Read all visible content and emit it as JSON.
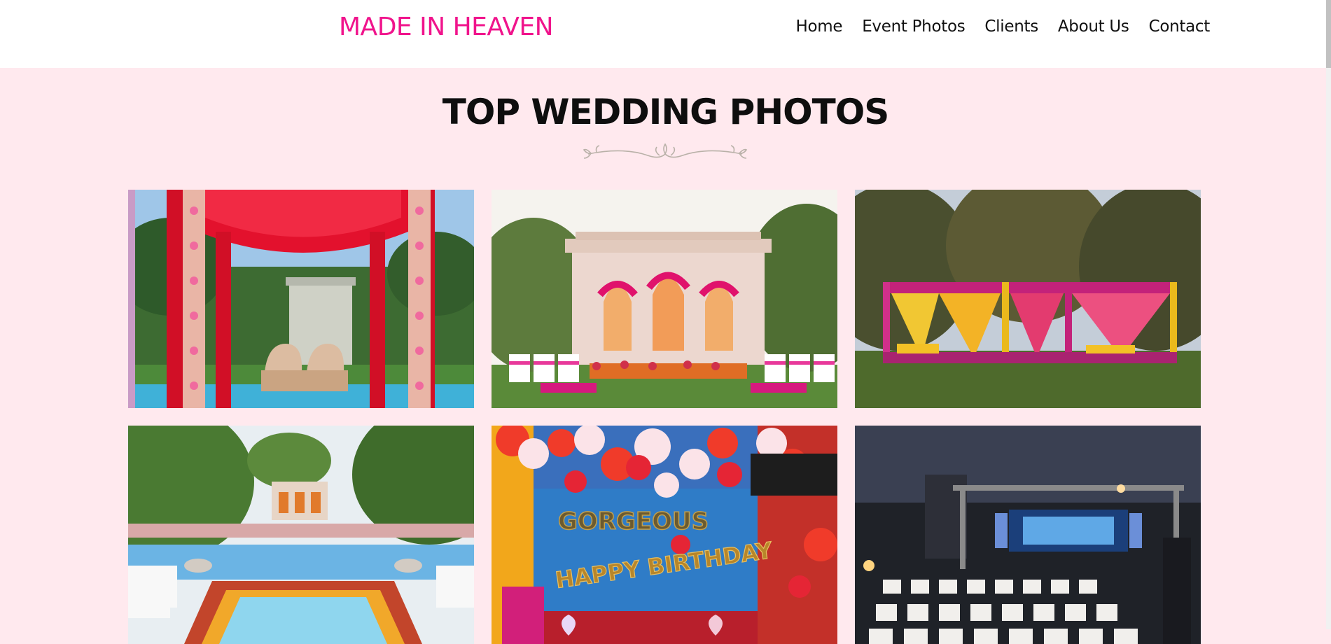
{
  "header": {
    "brand": "MADE IN HEAVEN",
    "nav": [
      {
        "label": "Home"
      },
      {
        "label": "Event Photos"
      },
      {
        "label": "Clients"
      },
      {
        "label": "About Us"
      },
      {
        "label": "Contact"
      }
    ]
  },
  "main": {
    "heading": "TOP WEDDING PHOTOS",
    "divider_icon": "floral-divider-icon"
  },
  "gallery": {
    "photos": [
      {
        "subject": "Red mandap with floral pillars and two gold chairs by pool"
      },
      {
        "subject": "White palace stage with pink arches and white chairs on lawn"
      },
      {
        "subject": "Colorful yellow and pink drape gazebos on lawn at sunset"
      },
      {
        "subject": "Poolside decor with white palace and flower borders"
      },
      {
        "subject": "Happy Birthday balloon decor with red and white balloons"
      },
      {
        "subject": "Night stage with lighting truss and rows of chairs"
      }
    ],
    "birthday_text": [
      "GORGEOUS",
      "HAPPY BIRTHDAY"
    ]
  },
  "colors": {
    "brand": "#f0148c",
    "page_bg": "#ffe9ee",
    "nav_bg": "#ffffff",
    "heading": "#0e0e0e"
  }
}
